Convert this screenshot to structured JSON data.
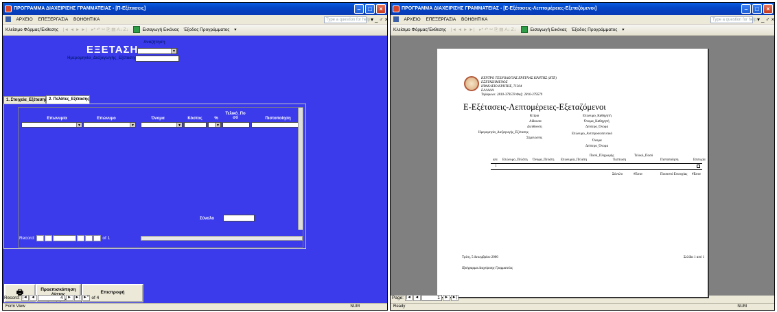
{
  "left": {
    "title": "ΠΡΟΓΡΑΜΜΑ ΔΙΑΧΕΙΡΙΣΗΣ ΓΡΑΜΜΑΤΕΙΑΣ - [Π-Εξέτασεις]",
    "menu": [
      "ΑΡΧΕΙΟ",
      "ΕΠΕΞΕΡΓΑΣΙΑ",
      "ΒΟΗΘΗΤΙΚΑ"
    ],
    "help_placeholder": "Type a question for help",
    "toolbar": {
      "close_label": "Κλείσιμο Φόρμας/Έκθεσης",
      "export_label": "Εισαγωγή Εικόνας",
      "exit_label": "Έξοδος Προγράμματος"
    },
    "form": {
      "title": "ΕΞΕΤΑΣΗ",
      "search_label": "Αναζήτηση",
      "date_label": "Ημερομηνία_Διεξαγωγής_Εξέτασης",
      "tabs": [
        "1. Στοιχεία_Εξέτασης",
        "2. Πελάτες_Εξέτασης"
      ],
      "columns": [
        "Επωνυμία",
        "Επώνυμο",
        "Όνομα",
        "Κόστος",
        "%",
        "Τελικό_Πο σό",
        "Πιστοποίηση"
      ],
      "total_label": "Σύνολο",
      "sub_record_label": "Record:",
      "sub_record_value": "1",
      "sub_record_total": "of 1",
      "print_button": "Προεπισκόπηση Λίστας Εξεταζόμενων",
      "back_button": "Επιστροφή",
      "record_label": "Record:",
      "record_value": "4",
      "record_total": "of 4",
      "status": "Form View",
      "status_num": "NUM"
    }
  },
  "right": {
    "title": "ΠΡΟΓΡΑΜΜΑ ΔΙΑΧΕΙΡΙΣΗΣ ΓΡΑΜΜΑΤΕΙΑΣ - [Ε-Εξέτασεις-Λεπτομέρειες-Εξεταζόμενοι]",
    "menu": [
      "ΑΡΧΕΙΟ",
      "ΕΠΕΞΕΡΓΑΣΙΑ",
      "ΒΟΗΘΗΤΙΚΑ"
    ],
    "help_placeholder": "Type a question for help",
    "toolbar": {
      "close_label": "Κλείσιμο Φόρμας/Έκθεσης",
      "export_label": "Εισαγωγή Εικόνας",
      "exit_label": "Έξοδος Προγράμματος"
    },
    "report": {
      "org_lines": [
        "ΚΕΝΤΡΟ ΤΕΧΝΟΛΟΓΙΑΣ ΕΡΕΥΝΑΣ ΚΡΗΤΗΣ (ΚΤΕ)",
        "ΕΞΕΤΑΣΗΜΕΝΟΣ",
        "ΗΡΑΚΛΕΙΟ ΚΡΗΤΗΣ, 71304",
        "ΕΛΛΑΔΑ",
        "Τηλέφωνο: 2810-379578 Φαξ: 2810-379579"
      ],
      "title": "Ε-Εξέτασεις-Λεπτομέρειες-Εξεταζόμενοι",
      "left_fields": [
        "Κτίριο",
        "Αίθουσα",
        "Διεύθυνση",
        "Ημερομηνία_Διεξαγωγής_Εξέτασης",
        "Σημειώσεις"
      ],
      "right_fields": [
        "Επώνυμο_Καθηγητή",
        "Όνομα_Καθηγητή",
        "Δεύτερο_Όνομα",
        "Επώνυμο_Αντιπροσωπευτικό",
        "Όνομα",
        "Δεύτερο_Όνομα"
      ],
      "columns": [
        "α/α",
        "Επώνυμο_Πελάτη",
        "Όνομα_Πελάτη",
        "Επωνυμία_Πελάτη",
        "Ποσό_Πληρωμής",
        "Έκπτωση",
        "Τελικό_Ποσό",
        "Πιστοποίηση",
        "Επιτυχία"
      ],
      "row_number": "1",
      "total_label": "Σύνολο",
      "total_value": "#Error",
      "percent_label": "Ποσοστό Επιτυχίας",
      "percent_value": "#Error",
      "footer_date": "Τρίτη, 5 Δεκεμβρίου 2006",
      "footer_page": "Σελίδα 1 από 1",
      "footer_program": "Πρόγραμμα Διαχείρισης Γραμματείας"
    },
    "page_label": "Page:",
    "page_value": "1",
    "status": "Ready",
    "status_num": "NUM"
  }
}
